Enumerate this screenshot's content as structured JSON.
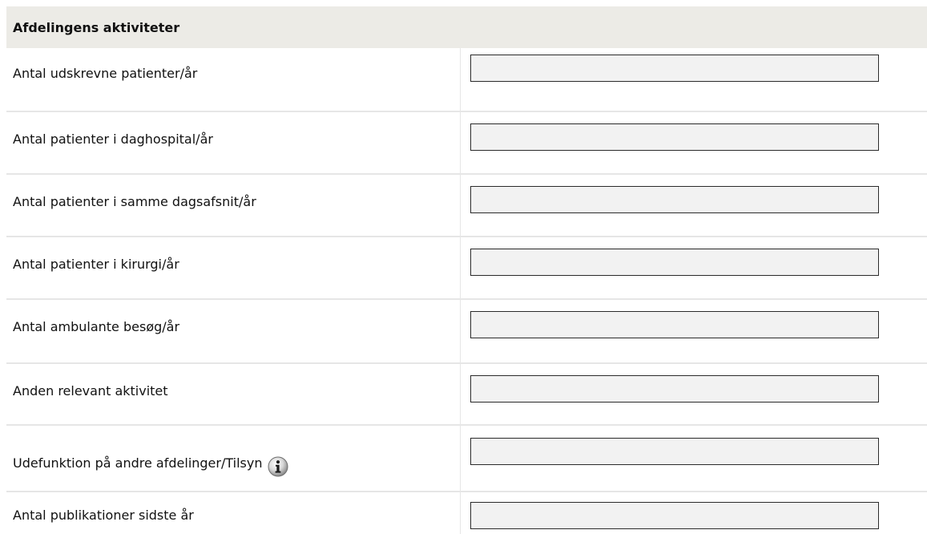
{
  "section": {
    "title": "Afdelingens aktiviteter"
  },
  "rows": [
    {
      "label": "Antal udskrevne patienter/år",
      "value": ""
    },
    {
      "label": "Antal patienter i daghospital/år",
      "value": ""
    },
    {
      "label": "Antal patienter i samme dagsafsnit/år",
      "value": ""
    },
    {
      "label": "Antal patienter i kirurgi/år",
      "value": ""
    },
    {
      "label": "Antal ambulante besøg/år",
      "value": ""
    },
    {
      "label": "Anden relevant aktivitet",
      "value": ""
    },
    {
      "label": "Udefunktion på andre afdelinger/Tilsyn",
      "value": "",
      "icon": "info-icon"
    },
    {
      "label": "Antal publikationer sidste år",
      "value": ""
    }
  ],
  "colors": {
    "header_bg": "#ecebe6",
    "input_bg": "#f2f2f2",
    "input_border": "#2b2b2b",
    "divider": "#e6e6e6"
  }
}
